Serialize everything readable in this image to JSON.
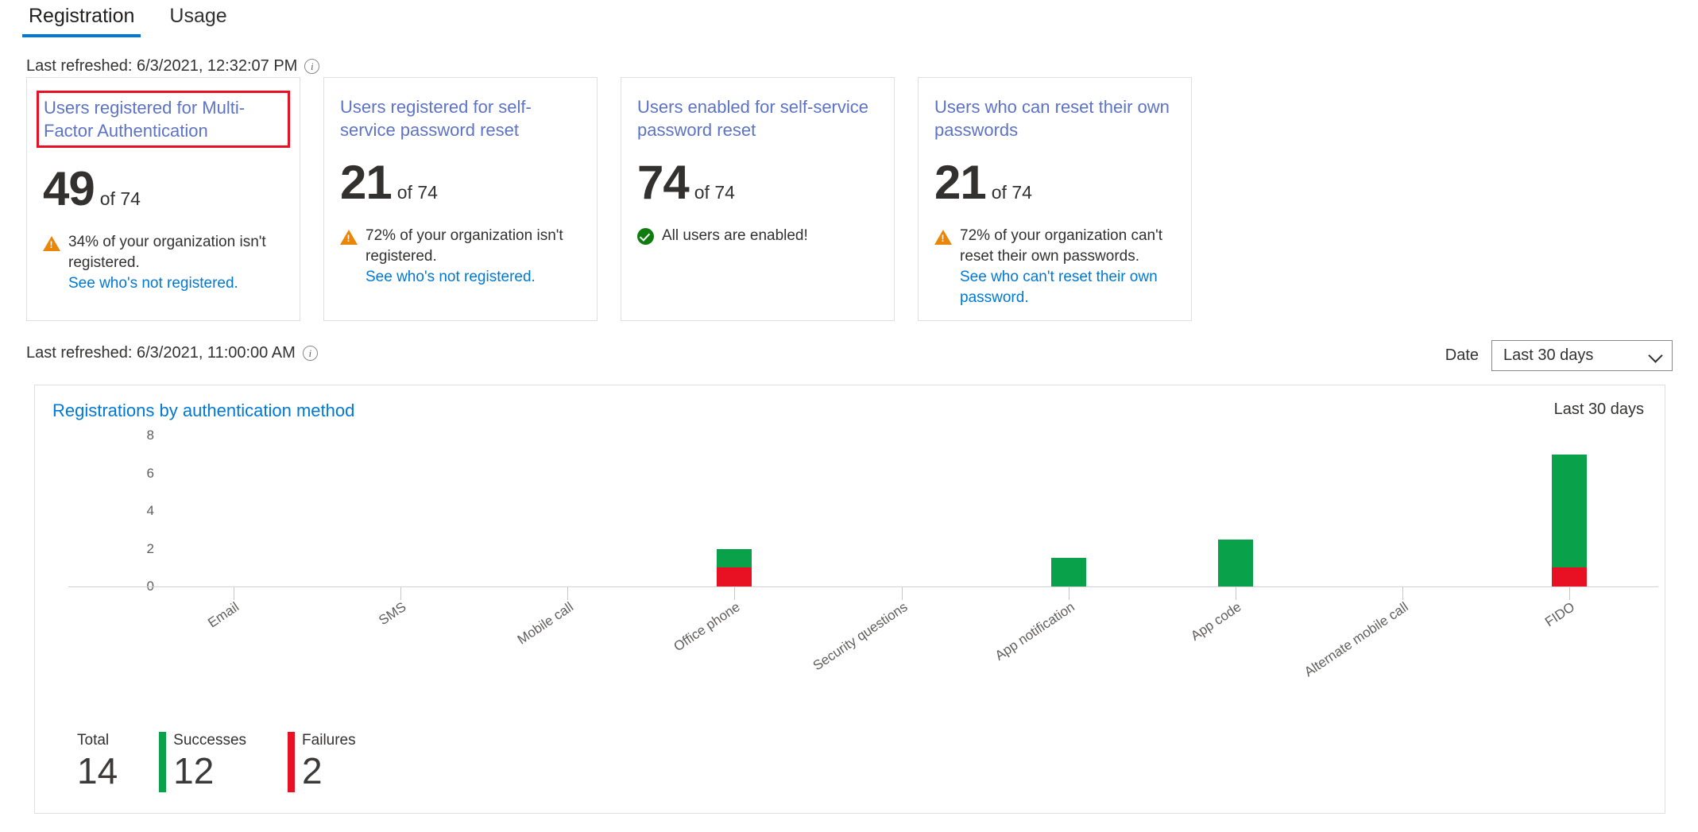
{
  "tabs": [
    {
      "label": "Registration",
      "active": true
    },
    {
      "label": "Usage",
      "active": false
    }
  ],
  "refresh_top": {
    "text": "Last refreshed: 6/3/2021, 12:32:07 PM",
    "info_icon": "info-icon"
  },
  "refresh_chart": {
    "text": "Last refreshed: 6/3/2021, 11:00:00 AM",
    "info_icon": "info-icon"
  },
  "cards": [
    {
      "title": "Users registered for Multi-Factor Authentication",
      "value": "49",
      "of": "of 74",
      "status_icon": "warning-icon",
      "status_text": "34% of your organization isn't registered.",
      "status_link": "See who's not registered.",
      "highlighted": true
    },
    {
      "title": "Users registered for self-service password reset",
      "value": "21",
      "of": "of 74",
      "status_icon": "warning-icon",
      "status_text": "72% of your organization isn't registered.",
      "status_link": "See who's not registered.",
      "highlighted": false
    },
    {
      "title": "Users enabled for self-service password reset",
      "value": "74",
      "of": "of 74",
      "status_icon": "success-icon",
      "status_text": "All users are enabled!",
      "status_link": "",
      "highlighted": false
    },
    {
      "title": "Users who can reset their own passwords",
      "value": "21",
      "of": "of 74",
      "status_icon": "warning-icon",
      "status_text": "72% of your organization can't reset their own passwords.",
      "status_link": "See who can't reset their own password.",
      "highlighted": false
    }
  ],
  "date_filter": {
    "label": "Date",
    "selected": "Last 30 days",
    "chevron_icon": "chevron-down-icon",
    "options": [
      "Last 30 days"
    ]
  },
  "chart_panel": {
    "title": "Registrations by authentication method",
    "range_label": "Last 30 days"
  },
  "chart_data": {
    "type": "bar",
    "title": "Registrations by authentication method",
    "stacked": true,
    "xlabel": "",
    "ylabel": "",
    "ylim": [
      0,
      8
    ],
    "yticks": [
      0,
      2,
      4,
      6,
      8
    ],
    "grid": false,
    "legend_position": "bottom",
    "categories": [
      "Email",
      "SMS",
      "Mobile call",
      "Office phone",
      "Security questions",
      "App notification",
      "App code",
      "Alternate mobile call",
      "FIDO"
    ],
    "series": [
      {
        "name": "Successes",
        "color": "#0aa14b",
        "values": [
          0,
          0,
          0,
          1,
          0,
          1.5,
          2.5,
          0,
          6
        ]
      },
      {
        "name": "Failures",
        "color": "#e81123",
        "values": [
          0,
          0,
          0,
          1,
          0,
          0,
          0,
          0,
          1
        ]
      }
    ]
  },
  "summary": [
    {
      "label": "Total",
      "value": "14",
      "swatch": "none"
    },
    {
      "label": "Successes",
      "value": "12",
      "swatch": "green"
    },
    {
      "label": "Failures",
      "value": "2",
      "swatch": "red"
    }
  ],
  "colors": {
    "accent": "#0078d4",
    "success": "#0aa14b",
    "failure": "#e81123",
    "warning": "#e8870a",
    "card_title": "#5d73c5",
    "highlight_border": "#e81123"
  }
}
